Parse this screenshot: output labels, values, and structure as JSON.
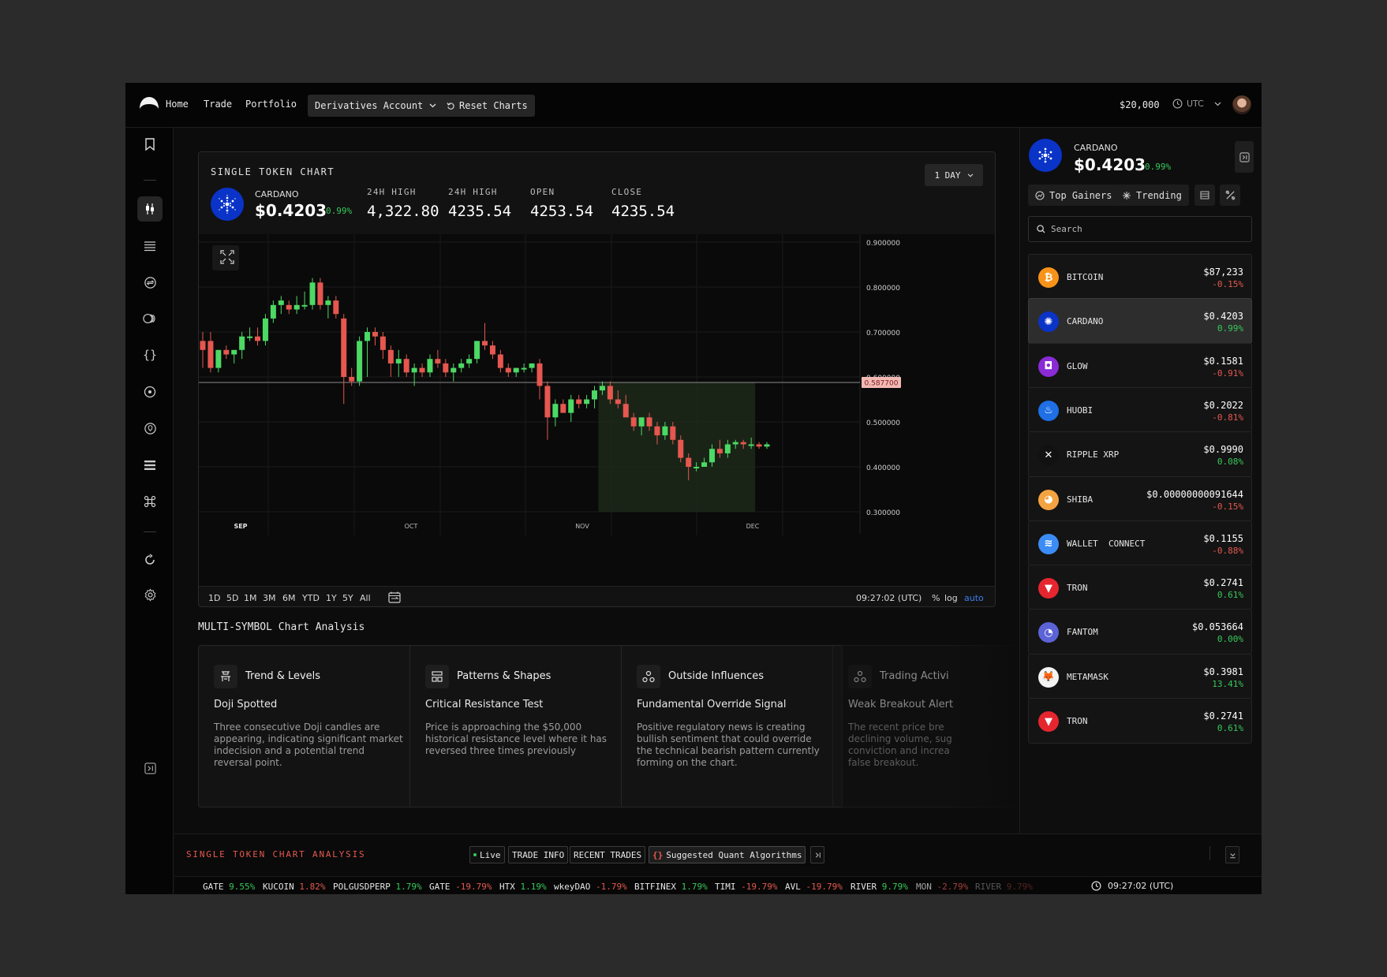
{
  "nav": {
    "links": [
      "Home",
      "Trade",
      "Portfolio"
    ],
    "account": "Derivatives Account",
    "reset": "Reset Charts",
    "balance": "$20,000",
    "timezone": "UTC"
  },
  "chart_card": {
    "title": "SINGLE TOKEN CHART",
    "token": {
      "name": "CARDANO",
      "price": "$0.4203",
      "change": "0.99%"
    },
    "stats": [
      {
        "label": "24H HIGH",
        "value": "4,322.80"
      },
      {
        "label": "24H HIGH",
        "value": "4235.54"
      },
      {
        "label": "OPEN",
        "value": "4253.54"
      },
      {
        "label": "CLOSE",
        "value": "4235.54"
      }
    ],
    "interval": "1 DAY",
    "timeframes": [
      "1D",
      "5D",
      "1M",
      "3M",
      "6M",
      "YTD",
      "1Y",
      "5Y",
      "All"
    ],
    "time": "09:27:02 (UTC)",
    "scale_opts": [
      "%",
      "log",
      "auto"
    ]
  },
  "chart_data": {
    "type": "candlestick",
    "y_ticks": [
      "0.900000",
      "0.800000",
      "0.700000",
      "0.600000",
      "0.500000",
      "0.400000",
      "0.300000"
    ],
    "ylim": [
      0.3,
      0.9
    ],
    "x_ticks": [
      "SEP",
      "OCT",
      "NOV",
      "DEC"
    ],
    "price_line": {
      "value": 0.5877,
      "label": "0.587700"
    },
    "candles": [
      [
        0.68,
        0.7,
        0.62,
        0.66
      ],
      [
        0.68,
        0.7,
        0.61,
        0.62
      ],
      [
        0.62,
        0.66,
        0.61,
        0.66
      ],
      [
        0.66,
        0.67,
        0.64,
        0.65
      ],
      [
        0.65,
        0.66,
        0.63,
        0.66
      ],
      [
        0.66,
        0.7,
        0.64,
        0.69
      ],
      [
        0.69,
        0.71,
        0.68,
        0.69
      ],
      [
        0.69,
        0.71,
        0.67,
        0.68
      ],
      [
        0.68,
        0.74,
        0.67,
        0.73
      ],
      [
        0.73,
        0.77,
        0.72,
        0.76
      ],
      [
        0.76,
        0.78,
        0.74,
        0.77
      ],
      [
        0.76,
        0.77,
        0.74,
        0.75
      ],
      [
        0.75,
        0.78,
        0.74,
        0.76
      ],
      [
        0.76,
        0.79,
        0.75,
        0.76
      ],
      [
        0.76,
        0.82,
        0.75,
        0.81
      ],
      [
        0.81,
        0.82,
        0.75,
        0.76
      ],
      [
        0.76,
        0.78,
        0.73,
        0.77
      ],
      [
        0.77,
        0.78,
        0.73,
        0.74
      ],
      [
        0.73,
        0.74,
        0.54,
        0.6
      ],
      [
        0.6,
        0.62,
        0.58,
        0.59
      ],
      [
        0.59,
        0.69,
        0.58,
        0.68
      ],
      [
        0.68,
        0.71,
        0.6,
        0.7
      ],
      [
        0.7,
        0.71,
        0.67,
        0.69
      ],
      [
        0.69,
        0.7,
        0.64,
        0.66
      ],
      [
        0.66,
        0.67,
        0.6,
        0.63
      ],
      [
        0.63,
        0.66,
        0.6,
        0.64
      ],
      [
        0.64,
        0.65,
        0.6,
        0.61
      ],
      [
        0.61,
        0.63,
        0.58,
        0.62
      ],
      [
        0.62,
        0.63,
        0.6,
        0.61
      ],
      [
        0.61,
        0.65,
        0.6,
        0.64
      ],
      [
        0.64,
        0.66,
        0.62,
        0.63
      ],
      [
        0.63,
        0.64,
        0.6,
        0.61
      ],
      [
        0.61,
        0.63,
        0.59,
        0.62
      ],
      [
        0.62,
        0.64,
        0.61,
        0.63
      ],
      [
        0.63,
        0.65,
        0.62,
        0.64
      ],
      [
        0.64,
        0.68,
        0.63,
        0.68
      ],
      [
        0.68,
        0.72,
        0.66,
        0.67
      ],
      [
        0.67,
        0.68,
        0.64,
        0.65
      ],
      [
        0.65,
        0.66,
        0.61,
        0.62
      ],
      [
        0.62,
        0.63,
        0.6,
        0.61
      ],
      [
        0.61,
        0.62,
        0.6,
        0.62
      ],
      [
        0.62,
        0.63,
        0.61,
        0.62
      ],
      [
        0.62,
        0.63,
        0.61,
        0.63
      ],
      [
        0.63,
        0.64,
        0.55,
        0.58
      ],
      [
        0.58,
        0.59,
        0.46,
        0.51
      ],
      [
        0.51,
        0.55,
        0.49,
        0.54
      ],
      [
        0.54,
        0.55,
        0.52,
        0.52
      ],
      [
        0.52,
        0.56,
        0.5,
        0.55
      ],
      [
        0.55,
        0.56,
        0.53,
        0.54
      ],
      [
        0.54,
        0.56,
        0.53,
        0.55
      ],
      [
        0.55,
        0.58,
        0.53,
        0.57
      ],
      [
        0.57,
        0.59,
        0.56,
        0.58
      ],
      [
        0.58,
        0.59,
        0.54,
        0.55
      ],
      [
        0.55,
        0.57,
        0.53,
        0.54
      ],
      [
        0.54,
        0.56,
        0.51,
        0.51
      ],
      [
        0.51,
        0.52,
        0.48,
        0.49
      ],
      [
        0.49,
        0.51,
        0.47,
        0.51
      ],
      [
        0.51,
        0.52,
        0.48,
        0.49
      ],
      [
        0.49,
        0.5,
        0.45,
        0.47
      ],
      [
        0.47,
        0.5,
        0.46,
        0.49
      ],
      [
        0.49,
        0.5,
        0.45,
        0.46
      ],
      [
        0.46,
        0.47,
        0.41,
        0.42
      ],
      [
        0.42,
        0.43,
        0.37,
        0.4
      ],
      [
        0.4,
        0.41,
        0.39,
        0.4
      ],
      [
        0.4,
        0.42,
        0.4,
        0.41
      ],
      [
        0.41,
        0.45,
        0.4,
        0.44
      ],
      [
        0.44,
        0.46,
        0.42,
        0.43
      ],
      [
        0.43,
        0.46,
        0.42,
        0.45
      ],
      [
        0.45,
        0.46,
        0.44,
        0.455
      ],
      [
        0.455,
        0.46,
        0.44,
        0.45
      ],
      [
        0.45,
        0.465,
        0.44,
        0.45
      ],
      [
        0.45,
        0.455,
        0.44,
        0.445
      ],
      [
        0.445,
        0.455,
        0.44,
        0.45
      ]
    ]
  },
  "analysis": {
    "title": "MULTI-SYMBOL Chart Analysis",
    "cards": [
      {
        "title": "Trend & Levels",
        "subtitle": "Doji Spotted",
        "body": "Three consecutive Doji candles are appearing, indicating significant market indecision and a potential trend reversal point."
      },
      {
        "title": "Patterns & Shapes",
        "subtitle": "Critical Resistance Test",
        "body": "Price is approaching the $50,000 historical resistance level where it has reversed three times previously"
      },
      {
        "title": "Outside Influences",
        "subtitle": "Fundamental Override Signal",
        "body": "Positive regulatory news is creating bullish sentiment that could override the technical bearish pattern currently forming on the chart."
      },
      {
        "title": "Trading Activi",
        "subtitle": "Weak Breakout Alert",
        "body": "The recent price bre declining volume, sug conviction and increa false breakout."
      }
    ]
  },
  "right_panel": {
    "token": {
      "name": "CARDANO",
      "price": "$0.4203",
      "change": "0.99%"
    },
    "tabs": [
      "Top Gainers",
      "Trending"
    ],
    "search_placeholder": "Search",
    "coins": [
      {
        "name": "BITCOIN",
        "price": "$87,233",
        "change": "-0.15%",
        "dir": "dn",
        "color": "#f7931a",
        "glyph": "₿"
      },
      {
        "name": "CARDANO",
        "price": "$0.4203",
        "change": "0.99%",
        "dir": "up",
        "color": "#0a33c8",
        "glyph": "✺"
      },
      {
        "name": "GLOW",
        "price": "$0.1581",
        "change": "-0.91%",
        "dir": "dn",
        "color": "#8a2bd6",
        "glyph": "◘"
      },
      {
        "name": "HUOBI",
        "price": "$0.2022",
        "change": "-0.81%",
        "dir": "dn",
        "color": "#1f6fe5",
        "glyph": "♨"
      },
      {
        "name": "RIPPLE XRP",
        "price": "$0.9990",
        "change": "0.08%",
        "dir": "up",
        "color": "#111111",
        "glyph": "✕"
      },
      {
        "name": "SHIBA",
        "price": "$0.00000000091644",
        "change": "-0.15%",
        "dir": "dn",
        "color": "#f4a340",
        "glyph": "◕"
      },
      {
        "name": "WALLET  CONNECT",
        "price": "$0.1155",
        "change": "-0.88%",
        "dir": "dn",
        "color": "#3b8df5",
        "glyph": "≋"
      },
      {
        "name": "TRON",
        "price": "$0.2741",
        "change": "0.61%",
        "dir": "up",
        "color": "#e5262f",
        "glyph": "▼"
      },
      {
        "name": "FANTOM",
        "price": "$0.053664",
        "change": "0.00%",
        "dir": "up",
        "color": "#5b63d6",
        "glyph": "◔"
      },
      {
        "name": "METAMASK",
        "price": "$0.3981",
        "change": "13.41%",
        "dir": "up",
        "color": "#f3f3f3",
        "glyph": "🦊"
      },
      {
        "name": "TRON",
        "price": "$0.2741",
        "change": "0.61%",
        "dir": "up",
        "color": "#e5262f",
        "glyph": "▼"
      }
    ]
  },
  "bottom": {
    "title": "SINGLE TOKEN CHART ANALYSIS",
    "chips": [
      "Live",
      "TRADE INFO",
      "RECENT TRADES",
      "Suggested Quant Algorithms"
    ],
    "ticker": [
      {
        "sym": "GATE",
        "chg": "9.55%",
        "dir": "up"
      },
      {
        "sym": "KUCOIN",
        "chg": "1.82%",
        "dir": "dn"
      },
      {
        "sym": "POLGUSDPERP",
        "chg": "1.79%",
        "dir": "up"
      },
      {
        "sym": "GATE",
        "chg": "-19.79%",
        "dir": "dn"
      },
      {
        "sym": "HTX",
        "chg": "1.19%",
        "dir": "up"
      },
      {
        "sym": "wkeyDAO",
        "chg": "-1.79%",
        "dir": "dn"
      },
      {
        "sym": "BITFINEX",
        "chg": "1.79%",
        "dir": "up"
      },
      {
        "sym": "TIMI",
        "chg": "-19.79%",
        "dir": "dn"
      },
      {
        "sym": "AVL",
        "chg": "-19.79%",
        "dir": "dn"
      },
      {
        "sym": "RIVER",
        "chg": "9.79%",
        "dir": "up"
      },
      {
        "sym": "MON",
        "chg": "-2.79%",
        "dir": "dn"
      },
      {
        "sym": "RIVER",
        "chg": "9.79%",
        "dir": "dn"
      }
    ],
    "time": "09:27:02 (UTC)"
  }
}
